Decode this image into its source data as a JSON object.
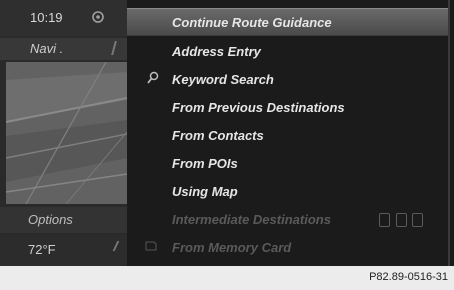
{
  "status": {
    "time": "10:19",
    "gps_icon": "gps-icon"
  },
  "left": {
    "navi_label": "Navi .",
    "options_label": "Options",
    "temperature": "72°F"
  },
  "menu": {
    "items": [
      {
        "label": "Continue Route Guidance",
        "selected": true
      },
      {
        "label": "Address Entry"
      },
      {
        "label": "Keyword Search",
        "icon": "search-icon"
      },
      {
        "label": "From Previous Destinations"
      },
      {
        "label": "From Contacts"
      },
      {
        "label": "From POIs"
      },
      {
        "label": "Using Map"
      },
      {
        "label": "Intermediate Destinations",
        "disabled": true,
        "icon": "media-icons"
      },
      {
        "label": "From Memory Card",
        "disabled": true,
        "icon": "memory-card-icon"
      }
    ]
  },
  "caption": "P82.89-0516-31"
}
